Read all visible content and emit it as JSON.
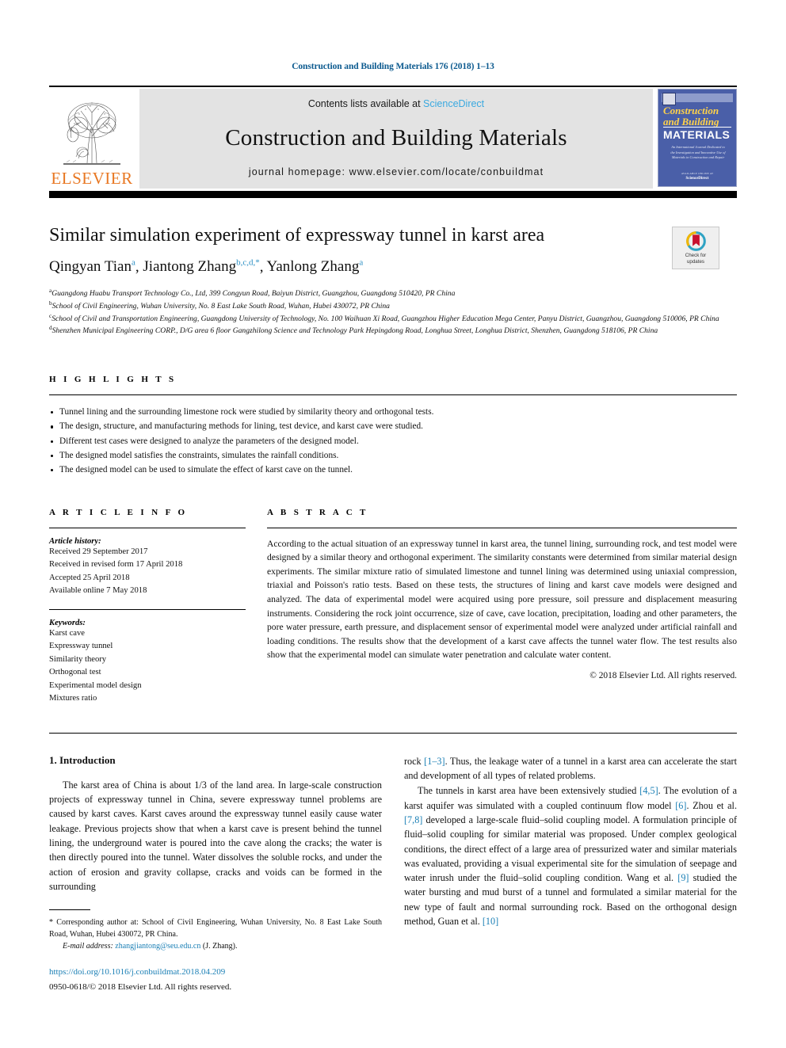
{
  "running_head": "Construction and Building Materials 176 (2018) 1–13",
  "masthead": {
    "contents_prefix": "Contents lists available at ",
    "sciencedirect": "ScienceDirect",
    "journal_title": "Construction and Building Materials",
    "homepage": "journal homepage: www.elsevier.com/locate/conbuildmat",
    "publisher_wordmark": "ELSEVIER",
    "cover": {
      "line1": "Construction",
      "line2": "and Building",
      "line3": "MATERIALS",
      "blurb": "An International Journal Dedicated to the Investigation and Innovative Use of Materials in Construction and Repair",
      "foot1": "AVAILABLE ONLINE AT",
      "foot2": "ScienceDirect"
    },
    "colors": {
      "sciencedirect_blue": "#3aa9e0",
      "elsevier_orange": "#e87722",
      "cover_blue": "#4a5fa8",
      "panel_grey": "#e3e3e3"
    }
  },
  "title": "Similar simulation experiment of expressway tunnel in karst area",
  "crossmark": {
    "line1": "Check for",
    "line2": "updates"
  },
  "authors": [
    {
      "name": "Qingyan Tian",
      "sup": "a",
      "sep": ", "
    },
    {
      "name": "Jiantong Zhang",
      "sup": "b,c,d,*",
      "sep": ", "
    },
    {
      "name": "Yanlong Zhang",
      "sup": "a",
      "sep": ""
    }
  ],
  "affiliations": [
    {
      "marker": "a",
      "text": "Guangdong Huabu Transport Technology Co., Ltd, 399 Congyun Road, Baiyun District, Guangzhou, Guangdong 510420, PR China"
    },
    {
      "marker": "b",
      "text": "School of Civil Engineering, Wuhan University, No. 8 East Lake South Road, Wuhan, Hubei 430072, PR China"
    },
    {
      "marker": "c",
      "text": "School of Civil and Transportation Engineering, Guangdong University of Technology, No. 100 Waihuan Xi Road, Guangzhou Higher Education Mega Center, Panyu District, Guangzhou, Guangdong 510006, PR China"
    },
    {
      "marker": "d",
      "text": "Shenzhen Municipal Engineering CORP., D/G area 6 floor Gangzhilong Science and Technology Park Hepingdong Road, Longhua Street, Longhua District, Shenzhen, Guangdong 518106, PR China"
    }
  ],
  "highlights": {
    "heading": "H I G H L I G H T S",
    "items": [
      "Tunnel lining and the surrounding limestone rock were studied by similarity theory and orthogonal tests.",
      "The design, structure, and manufacturing methods for lining, test device, and karst cave were studied.",
      "Different test cases were designed to analyze the parameters of the designed model.",
      "The designed model satisfies the constraints, simulates the rainfall conditions.",
      "The designed model can be used to simulate the effect of karst cave on the tunnel."
    ]
  },
  "article_info": {
    "heading": "A R T I C L E    I N F O",
    "history_label": "Article history:",
    "history": [
      "Received 29 September 2017",
      "Received in revised form 17 April 2018",
      "Accepted 25 April 2018",
      "Available online 7 May 2018"
    ],
    "keywords_label": "Keywords:",
    "keywords": [
      "Karst cave",
      "Expressway tunnel",
      "Similarity theory",
      "Orthogonal test",
      "Experimental model design",
      "Mixtures ratio"
    ]
  },
  "abstract": {
    "heading": "A B S T R A C T",
    "text": "According to the actual situation of an expressway tunnel in karst area, the tunnel lining, surrounding rock, and test model were designed by a similar theory and orthogonal experiment. The similarity constants were determined from similar material design experiments. The similar mixture ratio of simulated limestone and tunnel lining was determined using uniaxial compression, triaxial and Poisson's ratio tests. Based on these tests, the structures of lining and karst cave models were designed and analyzed. The data of experimental model were acquired using pore pressure, soil pressure and displacement measuring instruments. Considering the rock joint occurrence, size of cave, cave location, precipitation, loading and other parameters, the pore water pressure, earth pressure, and displacement sensor of experimental model were analyzed under artificial rainfall and loading conditions. The results show that the development of a karst cave affects the tunnel water flow. The test results also show that the experimental model can simulate water penetration and calculate water content.",
    "copyright": "© 2018 Elsevier Ltd. All rights reserved."
  },
  "body": {
    "section_heading": "1. Introduction",
    "left_paragraph": "The karst area of China is about 1/3 of the land area. In large-scale construction projects of expressway tunnel in China, severe expressway tunnel problems are caused by karst caves. Karst caves around the expressway tunnel easily cause water leakage. Previous projects show that when a karst cave is present behind the tunnel lining, the underground water is poured into the cave along the cracks; the water is then directly poured into the tunnel. Water dissolves the soluble rocks, and under the action of erosion and gravity collapse, cracks and voids can be formed in the surrounding",
    "right_paragraph_1_pre": "rock ",
    "right_paragraph_1_ref": "[1–3]",
    "right_paragraph_1_post": ". Thus, the leakage water of a tunnel in a karst area can accelerate the start and development of all types of related problems.",
    "right_paragraph_2_a": "The tunnels in karst area have been extensively studied ",
    "right_ref_45": "[4,5]",
    "right_paragraph_2_b": ". The evolution of a karst aquifer was simulated with a coupled continuum flow model ",
    "right_ref_6": "[6]",
    "right_paragraph_2_c": ". Zhou et al. ",
    "right_ref_78": "[7,8]",
    "right_paragraph_2_d": " developed a large-scale fluid–solid coupling model. A formulation principle of fluid–solid coupling for similar material was proposed. Under complex geological conditions, the direct effect of a large area of pressurized water and similar materials was evaluated, providing a visual experimental site for the simulation of seepage and water inrush under the fluid–solid coupling condition. Wang et al. ",
    "right_ref_9": "[9]",
    "right_paragraph_2_e": " studied the water bursting and mud burst of a tunnel and formulated a similar material for the new type of fault and normal surrounding rock. Based on the orthogonal design method, Guan et al. ",
    "right_ref_10": "[10]"
  },
  "footnote": {
    "star": "*",
    "corresponding": " Corresponding author at: School of Civil Engineering, Wuhan University, No. 8 East Lake South Road, Wuhan, Hubei 430072, PR China.",
    "email_label": "E-mail address:",
    "email": "zhangjiantong@seu.edu.cn",
    "email_suffix": " (J. Zhang).",
    "doi": "https://doi.org/10.1016/j.conbuildmat.2018.04.209",
    "issn": "0950-0618/© 2018 Elsevier Ltd. All rights reserved."
  }
}
